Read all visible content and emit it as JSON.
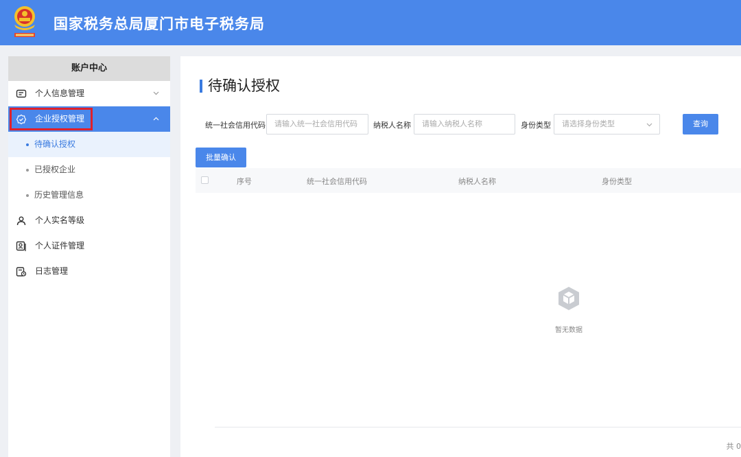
{
  "header": {
    "title": "国家税务总局厦门市电子税务局"
  },
  "sidebar": {
    "title": "账户中心",
    "items": [
      {
        "label": "个人信息管理",
        "icon": "id-card-icon"
      },
      {
        "label": "企业授权管理",
        "icon": "badge-check-icon"
      },
      {
        "label": "个人实名等级",
        "icon": "user-level-icon"
      },
      {
        "label": "个人证件管理",
        "icon": "certificate-icon"
      },
      {
        "label": "日志管理",
        "icon": "log-clock-icon"
      }
    ],
    "sub_items": [
      {
        "label": "待确认授权"
      },
      {
        "label": "已授权企业"
      },
      {
        "label": "历史管理信息"
      }
    ]
  },
  "main": {
    "title": "待确认授权",
    "filters": {
      "credit_code_label": "统一社会信用代码",
      "credit_code_placeholder": "请输入统一社会信用代码",
      "taxpayer_name_label": "纳税人名称",
      "taxpayer_name_placeholder": "请输入纳税人名称",
      "identity_type_label": "身份类型",
      "identity_type_placeholder": "请选择身份类型",
      "query_button": "查询"
    },
    "batch_confirm_button": "批量确认",
    "table": {
      "columns": [
        "序号",
        "统一社会信用代码",
        "纳税人名称",
        "身份类型"
      ]
    },
    "empty_text": "暂无数据",
    "total_text": "共 0"
  },
  "colors": {
    "brand": "#4a87ea",
    "highlight": "#e0202a",
    "accent": "#3a7be0"
  }
}
